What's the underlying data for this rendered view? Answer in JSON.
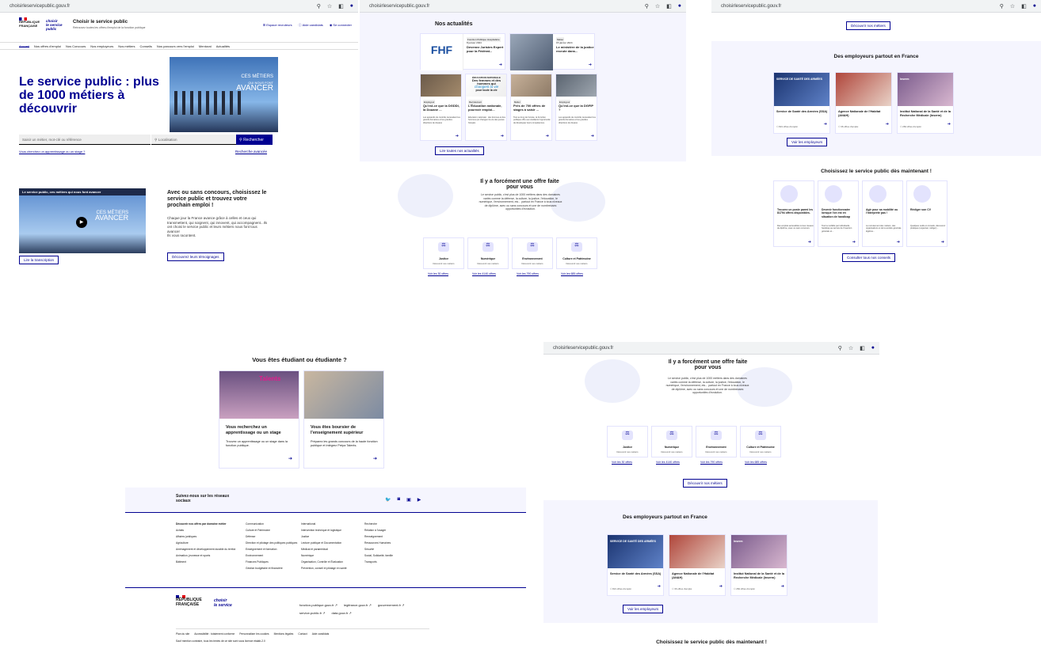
{
  "browser": {
    "url": "choisirleservicepublic.gouv.fr"
  },
  "header": {
    "rf1": "RÉPUBLIQUE",
    "rf2": "FRANÇAISE",
    "brand1": "choisir",
    "brand2": "le service",
    "brand3": "public",
    "title": "Choisir le service public",
    "subtitle": "Retrouvez toutes les offres d'emploi de la fonction publique",
    "recruiters": "Espace recruteurs",
    "help": "Aide candidats",
    "login": "Se connecter"
  },
  "nav": [
    "Accueil",
    "Nos offres d'emploi",
    "Nos Concours",
    "Nos employeurs",
    "Nos métiers",
    "Conseils",
    "Nos parcours vers l'emploi",
    "Mentorat",
    "Actualités"
  ],
  "hero": {
    "title": "Le service public : plus de 1000 métiers à découvrir",
    "banner1": "CES MÉTIERS",
    "banner2": "QUI NOUS FONT",
    "banner3": "AVANCER",
    "search_placeholder": "Saisir un métier, mot-clé ou référence",
    "location_placeholder": "Localisation",
    "search_btn": "Rechercher",
    "stage_link": "Vous cherchez un apprentissage ou un stage ?",
    "advanced": "Recherche avancée"
  },
  "video": {
    "caption": "Le service public, ces métiers qui nous font avancer",
    "transcript": "Lire la transcription",
    "title": "Avec ou sans concours, choisissez le service public et trouvez votre prochain emploi !",
    "text": "Chaque jour la France avance grâce à celles et ceux qui transmettent, qui soignent, qui innovent, qui accompagnent...Ils ont choisi le service public et leurs métiers nous font tous avancer",
    "text2": "Ils vous racontent.",
    "btn": "Découvrez leurs témoignages"
  },
  "news": {
    "title": "Nos actualités",
    "items": [
      {
        "tag": "Fonction Publique Hospitalière",
        "date": "8 janvier 2024",
        "title": "Devenez Juristes Expert pour la Fédérat..."
      },
      {
        "tag": "Métier",
        "date": "15 janvier 2024",
        "title": "Le ministère de la justice recrute dans..."
      },
      {
        "tag": "Employeur",
        "title": "Qu'est-ce que la DGDDI, la Douane ...",
        "text": "Les appareils de contrôle nécessitent les grands domaines et les grandes directions de douane"
      },
      {
        "tag": "Recrutement",
        "title": "L'Éducation nationale, pourvoir emploi...",
        "text": "Éducation nationale : des femmes et des hommes qui changent la vie des jeunes français"
      },
      {
        "tag": "Métier",
        "title": "Près de 700 offres de stages à saisir ...",
        "text": "Tout au long de l'année, la Fonction publique offre aux étudiants l'opportunité de développer leurs compétences."
      },
      {
        "tag": "Employeur",
        "title": "Qu'est-ce que la DGFIP ?",
        "text": "Les appareils de contrôle nécessitent les grands domaines et les grandes directions de douane"
      }
    ],
    "img_fhf": "FHF",
    "img_edu1": "ÉDUCATION NATIONALE",
    "img_edu2": "Des femmes et des hommes qui",
    "img_edu3": "changent la vie",
    "img_edu4": "pour toute la vie",
    "btn": "Lire toutes nos actualités"
  },
  "offer": {
    "title": "Il y a forcément une offre faite pour vous",
    "text": "Le service public, c'est plus de 1000 métiers dans des domaines variés comme la défense, la culture, la justice, l'éducation, le numérique, l'environnement, etc... partout en France à tous niveaux de diplôme, avec ou sans concours et une de nombreuses opportunités d'évolution.",
    "domains": [
      {
        "name": "Justice",
        "sub": "Découvrir ces métiers",
        "link": "Voir les 30 offres"
      },
      {
        "name": "Numérique",
        "sub": "Découvrir ces métiers",
        "link": "Voir les 4140 offres"
      },
      {
        "name": "Environnement",
        "sub": "Découvrir ces métiers",
        "link": "Voir les 790 offres"
      },
      {
        "name": "Culture et Patrimoine",
        "sub": "Découvrir ces métiers",
        "link": "Voir les 685 offres"
      }
    ],
    "domains_b": [
      {
        "link": "Voir les 30 offres"
      },
      {
        "link": "Voir les 4140 offres"
      },
      {
        "link": "Voir les 790 offres"
      },
      {
        "link": "Voir les 685 offres"
      }
    ],
    "btn": "Découvrir nos métiers"
  },
  "employers": {
    "title": "Des employeurs partout en France",
    "items": [
      {
        "name": "Service de Santé des Armées (SSA)",
        "count": "821 offres d'emploi",
        "img": "SERVICE DE SANTÉ DES ARMÉES"
      },
      {
        "name": "Agence Nationale de l'Habitat (ANAH)",
        "count": "36 offres d'emploi",
        "img": ""
      },
      {
        "name": "Institut National de la Santé et de la Recherche Médicale (Inserm)",
        "count": "284 offres d'emploi",
        "img": "Inserm"
      }
    ],
    "btn": "Voir les employeurs"
  },
  "choose": {
    "title": "Choisissez le service public dès maintenant !",
    "items": [
      {
        "title": "Trouvez un poste parmi les 81794 offres disponibles.",
        "text": "Des emplois accessibles à tous niveaux de diplôme, avec ou sans concours."
      },
      {
        "title": "Devenir fonctionnaire lorsque l'on est en situation de handicap",
        "text": "Tout la mobilité par individuelle handicap au service de l'insertion générale et..."
      },
      {
        "title": "Agir pour sa mobilité ou l'interprète pas !",
        "text": "Le recrutement des métiers, des organisations et de la société générale légitime..."
      },
      {
        "title": "Rédiger son CV",
        "text": "Quelques outils et conseils, découvrez pratiques (organiser, rédiger)..."
      }
    ],
    "btn": "Consulter tous nos conseils"
  },
  "student": {
    "title": "Vous êtes étudiant ou étudiante ?",
    "talents": "Talents",
    "items": [
      {
        "title": "Vous recherchez un apprentissage ou un stage",
        "text": "Trouvez un apprentissage ou un stage dans la fonction publique."
      },
      {
        "title": "Vous êtes boursier de l'enseignement supérieur",
        "text": "Préparez les grands concours de la haute fonction publique et intégrez Prépa Talents."
      }
    ]
  },
  "footer": {
    "social_title": "Suivez-nous sur les réseaux sociaux",
    "col_head": "Découvrir nos offres par domaine métier",
    "col1": [
      "Achats",
      "Affaires juridiques",
      "Agriculture",
      "Aménagement et développement durable du territoire",
      "Animation, jeunesse et sports",
      "Bâtiment"
    ],
    "col2": [
      "Communication",
      "Culture et Patrimoine",
      "Défense",
      "Direction et pilotage des politiques publiques",
      "Enseignement et formation",
      "Environnement",
      "Finances Publiques",
      "Gestion budgétaire et financière"
    ],
    "col3": [
      "International",
      "Intervention technique et logistique",
      "Justice",
      "Lecture publique et Documentation",
      "Médical et paramédical",
      "Numérique",
      "Organisation, Contrôle et Évaluation",
      "Prévention, conseil et pilotage en santé"
    ],
    "col4": [
      "Recherche",
      "Relation à l'usager",
      "Renseignement",
      "Ressources Humaines",
      "Sécurité",
      "Social, Solidarité, famille",
      "Transports"
    ],
    "ext": [
      "fonction-publique.gouv.fr",
      "legifrance.gouv.fr",
      "gouvernement.fr",
      "service-public.fr",
      "data.gouv.fr"
    ],
    "legal": [
      "Plan du site",
      "Accessibilité : totalement conforme",
      "Personnaliser les cookies",
      "Mentions légales",
      "Contact",
      "Aide candidats"
    ],
    "licence": "Sauf mention contraire, tous les textes de ce site sont sous licence etalab-2.0"
  },
  "colors": {
    "primary": "#000091",
    "soft": "#f5f5fe"
  }
}
